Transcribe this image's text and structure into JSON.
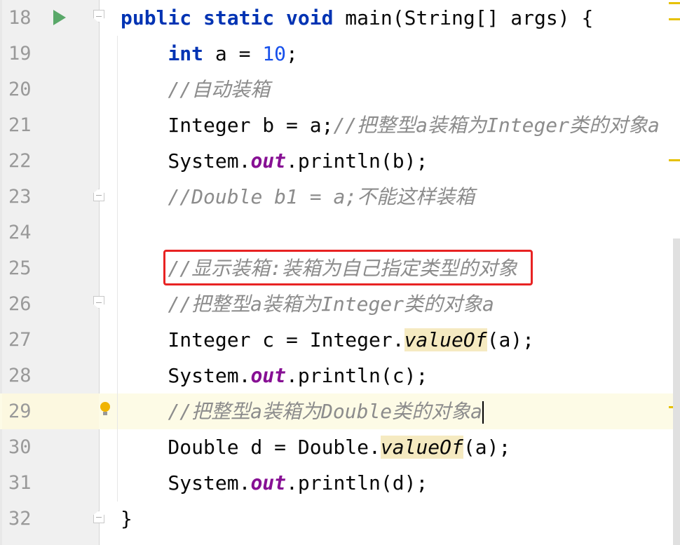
{
  "editor": {
    "current_line": 29,
    "colors": {
      "keyword": "#0033b3",
      "number": "#1750eb",
      "comment": "#8c8c8c",
      "static_field": "#871094",
      "highlight_box": "#e82323",
      "run_icon": "#59a869"
    },
    "lines": [
      {
        "n": "18",
        "icon": "run-icon",
        "fold": "start",
        "tokens": [
          [
            "kw",
            "public static void "
          ],
          [
            "",
            "main(String[] args) {"
          ]
        ]
      },
      {
        "n": "19",
        "tokens": [
          [
            "",
            "    "
          ],
          [
            "kw",
            "int"
          ],
          [
            "",
            " a = "
          ],
          [
            "num",
            "10"
          ],
          [
            "",
            ";"
          ]
        ]
      },
      {
        "n": "20",
        "tokens": [
          [
            "",
            "    "
          ],
          [
            "cm",
            "//自动装箱"
          ]
        ]
      },
      {
        "n": "21",
        "tokens": [
          [
            "",
            "    Integer b = a;"
          ],
          [
            "cm",
            "//把整型a装箱为Integer类的对象a"
          ]
        ]
      },
      {
        "n": "22",
        "tokens": [
          [
            "",
            "    System."
          ],
          [
            "st",
            "out"
          ],
          [
            "",
            ".println(b);"
          ]
        ]
      },
      {
        "n": "23",
        "fold": "end",
        "tokens": [
          [
            "",
            "    "
          ],
          [
            "cm",
            "//Double b1 = a;不能这样装箱"
          ]
        ]
      },
      {
        "n": "24",
        "tokens": []
      },
      {
        "n": "25",
        "tokens": [
          [
            "",
            "    "
          ],
          [
            "cm",
            "//显示装箱:装箱为自己指定类型的对象"
          ]
        ]
      },
      {
        "n": "26",
        "fold": "start",
        "tokens": [
          [
            "",
            "    "
          ],
          [
            "cm",
            "//把整型a装箱为Integer类的对象a"
          ]
        ]
      },
      {
        "n": "27",
        "tokens": [
          [
            "",
            "    Integer c = Integer."
          ],
          [
            "mi",
            "valueOf"
          ],
          [
            "",
            "(a);"
          ]
        ]
      },
      {
        "n": "28",
        "tokens": [
          [
            "",
            "    System."
          ],
          [
            "st",
            "out"
          ],
          [
            "",
            ".println(c);"
          ]
        ]
      },
      {
        "n": "29",
        "icon": "lightbulb-icon",
        "tokens": [
          [
            "",
            "    "
          ],
          [
            "cm",
            "//把整型a装箱为Double类的对象a"
          ]
        ]
      },
      {
        "n": "30",
        "tokens": [
          [
            "",
            "    Double d = Double."
          ],
          [
            "mi",
            "valueOf"
          ],
          [
            "",
            "(a);"
          ]
        ]
      },
      {
        "n": "31",
        "tokens": [
          [
            "",
            "    System."
          ],
          [
            "st",
            "out"
          ],
          [
            "",
            ".println(d);"
          ]
        ]
      },
      {
        "n": "32",
        "fold": "end",
        "tokens": [
          [
            "",
            "}"
          ]
        ]
      }
    ]
  }
}
